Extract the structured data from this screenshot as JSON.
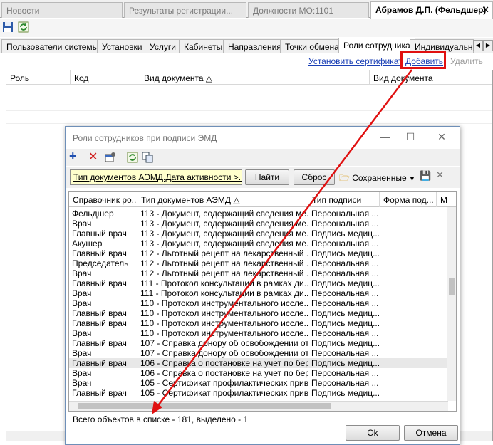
{
  "top_tabs": [
    {
      "label": "Новости"
    },
    {
      "label": "Результаты  регистрации..."
    },
    {
      "label": "Должности МО:1101"
    },
    {
      "label": "Абрамов Д.П. (Фельдшер)"
    }
  ],
  "sub_tabs": [
    "Пользователи системы",
    "Установки",
    "Услуги",
    "Кабинеты",
    "Направления",
    "Точки обмена",
    "Роли сотрудника",
    "Индивидуальн"
  ],
  "actions": {
    "install_cert": "Установить сертификат",
    "add": "Добавить",
    "delete": "Удалить"
  },
  "main_columns": [
    "Роль",
    "Код",
    "Вид документа",
    "Вид документа"
  ],
  "dialog": {
    "title": "Роли сотрудников при подписи ЭМД",
    "filter_text": "Тип документов АЭМД.Дата активности >...",
    "find_label": "Найти",
    "reset_label": "Сброс",
    "saved_label": "Сохраненные",
    "columns": [
      "Справочник ро...",
      "Тип документов АЭМД",
      "Тип подписи",
      "Форма под...",
      "М"
    ],
    "rows": [
      {
        "role": "Фельдшер",
        "doc": "113 - Документ, содержащий сведения ме...",
        "sign": "Персональная ..."
      },
      {
        "role": "Врач",
        "doc": "113 - Документ, содержащий сведения ме...",
        "sign": "Персональная ..."
      },
      {
        "role": "Главный врач",
        "doc": "113 - Документ, содержащий сведения ме...",
        "sign": "Подпись медиц..."
      },
      {
        "role": "Акушер",
        "doc": "113 - Документ, содержащий сведения ме...",
        "sign": "Персональная ..."
      },
      {
        "role": "Главный врач",
        "doc": "112 - Льготный рецепт на лекарственный ...",
        "sign": "Подпись медиц..."
      },
      {
        "role": "Председатель",
        "doc": "112 - Льготный рецепт на лекарственный ...",
        "sign": "Персональная ..."
      },
      {
        "role": "Врач",
        "doc": "112 - Льготный рецепт на лекарственный ...",
        "sign": "Персональная ..."
      },
      {
        "role": "Главный врач",
        "doc": "111 - Протокол консультации в рамках ди...",
        "sign": "Подпись медиц..."
      },
      {
        "role": "Врач",
        "doc": "111 - Протокол консультации в рамках ди...",
        "sign": "Персональная ..."
      },
      {
        "role": "Врач",
        "doc": "110 - Протокол инструментального иссле...",
        "sign": "Персональная ..."
      },
      {
        "role": "Главный врач",
        "doc": "110 - Протокол инструментального иссле...",
        "sign": "Подпись медиц..."
      },
      {
        "role": "Главный врач",
        "doc": "110 - Протокол инструментального иссле...",
        "sign": "Подпись медиц..."
      },
      {
        "role": "Врач",
        "doc": "110 - Протокол инструментального иссле...",
        "sign": "Персональная ..."
      },
      {
        "role": "Главный врач",
        "doc": "107 - Справка донору об освобождении от ...",
        "sign": "Подпись медиц..."
      },
      {
        "role": "Врач",
        "doc": "107 - Справка донору об освобождении от ...",
        "sign": "Персональная ..."
      },
      {
        "role": "Главный врач",
        "doc": "106 - Справка о постановке на учет по бер...",
        "sign": "Подпись медиц..."
      },
      {
        "role": "Врач",
        "doc": "106 - Справка о постановке на учет по бер...",
        "sign": "Персональная ..."
      },
      {
        "role": "Врач",
        "doc": "105 - Сертификат профилактических прив...",
        "sign": "Персональная ..."
      },
      {
        "role": "Главный врач",
        "doc": "105 - Сертификат профилактических прив...",
        "sign": "Подпись медиц..."
      }
    ],
    "status": "Всего объектов в списке - 181, выделено - 1",
    "ok_label": "Ok",
    "cancel_label": "Отмена"
  },
  "colors": {
    "highlight": "#e01010",
    "link": "#1a3fb5",
    "filter_bg": "#ffffcc"
  }
}
